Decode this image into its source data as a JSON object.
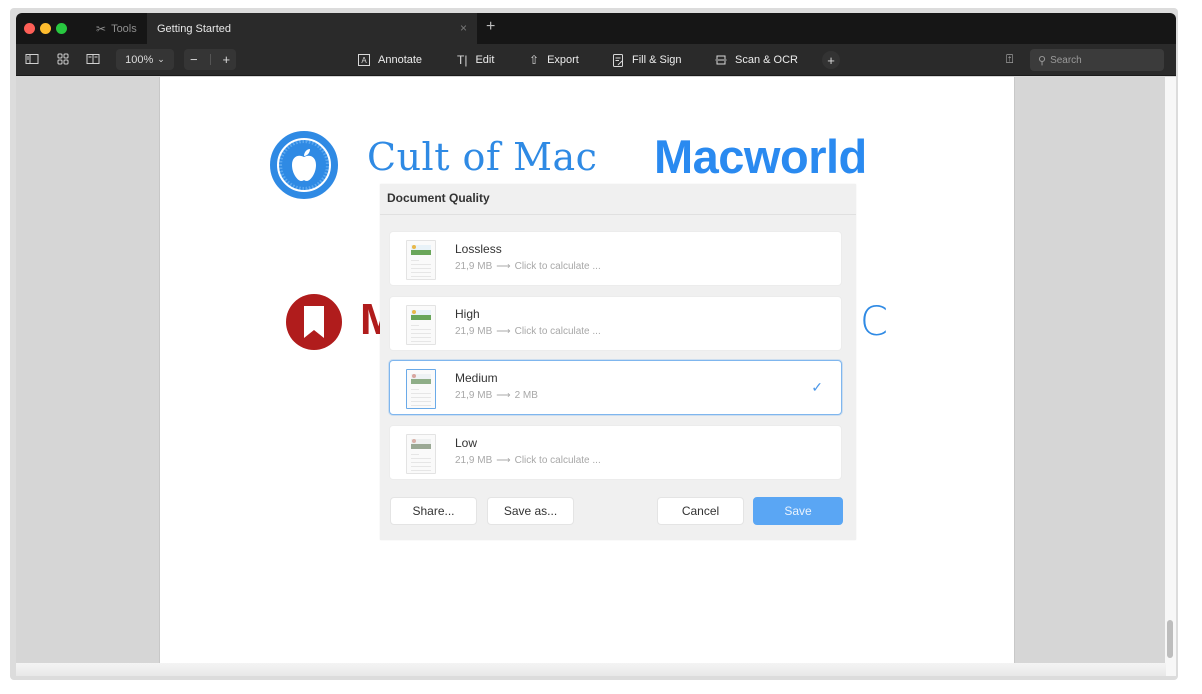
{
  "titlebar": {
    "tools_tab": "Tools",
    "doc_tab": "Getting Started",
    "close_glyph": "×",
    "new_tab_glyph": "+"
  },
  "toolbar": {
    "zoom_level": "100%",
    "zoom_out": "−",
    "zoom_in": "+",
    "annotate": "Annotate",
    "edit": "Edit",
    "export": "Export",
    "fill_sign": "Fill & Sign",
    "scan_ocr": "Scan & OCR",
    "add": "+",
    "search_placeholder": "Search"
  },
  "page": {
    "logo_cult_of_mac": "Cult of Mac",
    "logo_macworld": "Macworld",
    "logo_red_partial": "M",
    "logo_blue_partial": "C"
  },
  "dialog": {
    "title": "Document Quality",
    "options": [
      {
        "title": "Lossless",
        "from": "21,9 MB",
        "arrow": "⟶",
        "to": "Click to calculate ...",
        "selected": false
      },
      {
        "title": "High",
        "from": "21,9 MB",
        "arrow": "⟶",
        "to": "Click to calculate ...",
        "selected": false
      },
      {
        "title": "Medium",
        "from": "21,9 MB",
        "arrow": "⟶",
        "to": "2 MB",
        "selected": true
      },
      {
        "title": "Low",
        "from": "21,9 MB",
        "arrow": "⟶",
        "to": "Click to calculate ...",
        "selected": false
      }
    ],
    "check_glyph": "✓",
    "buttons": {
      "share": "Share...",
      "save_as": "Save as...",
      "cancel": "Cancel",
      "save": "Save"
    }
  },
  "colors": {
    "accent": "#5aa6f4",
    "selection_border": "#7fb6ee",
    "cult_of_mac_blue": "#2f8ae4",
    "macworld_blue": "#2a8af0",
    "red_logo": "#b01c1c"
  }
}
